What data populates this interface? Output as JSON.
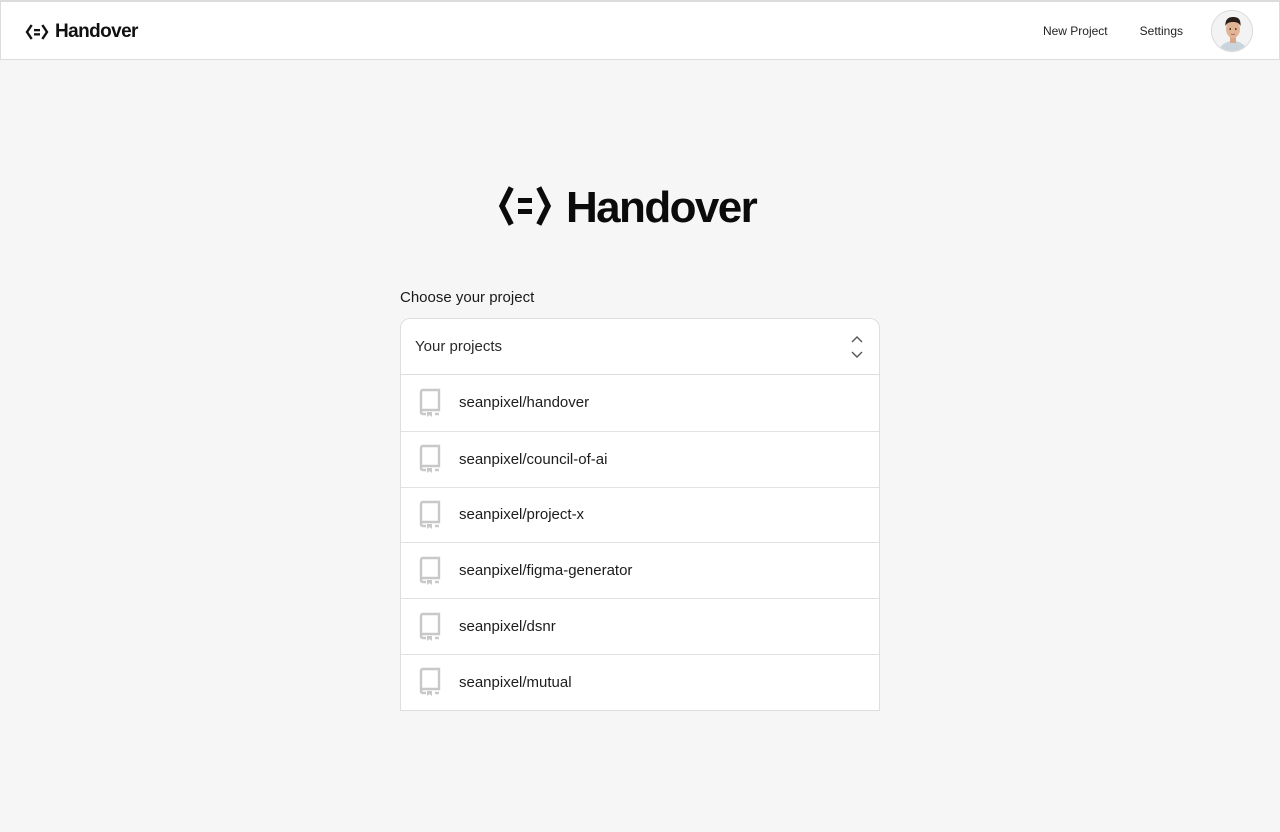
{
  "header": {
    "brand": "Handover",
    "nav": {
      "new_project": "New Project",
      "settings": "Settings"
    }
  },
  "hero": {
    "brand": "Handover"
  },
  "picker": {
    "label": "Choose your project",
    "select_value": "Your projects",
    "options": [
      "seanpixel/handover",
      "seanpixel/council-of-ai",
      "seanpixel/project-x",
      "seanpixel/figma-generator",
      "seanpixel/dsnr",
      "seanpixel/mutual"
    ]
  },
  "icons": {
    "logo": "handover-logo-icon",
    "select_toggle": "chevron-up-down-icon",
    "repo": "repo-icon",
    "avatar": "user-avatar"
  }
}
